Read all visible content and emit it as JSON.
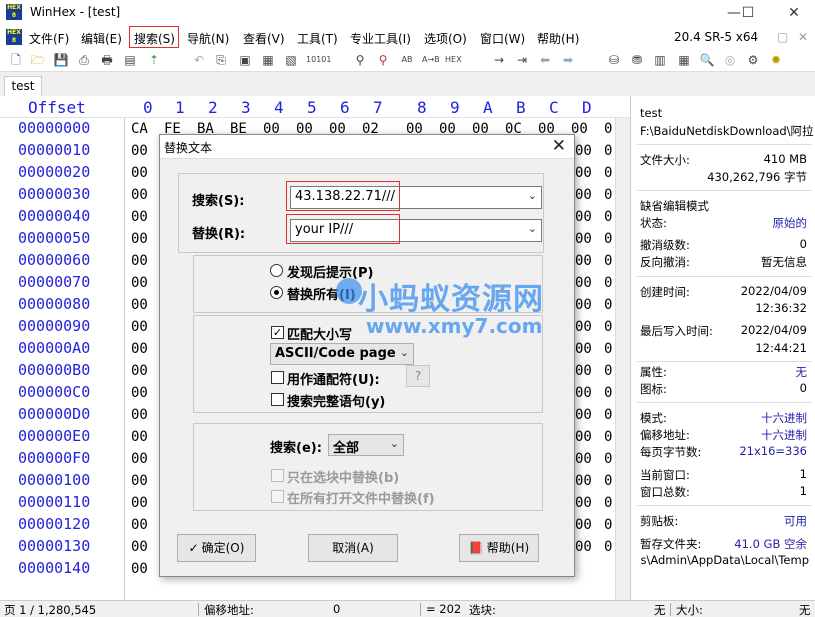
{
  "window": {
    "title": "WinHex - [test]"
  },
  "menu": {
    "items": [
      "文件(F)",
      "编辑(E)",
      "搜索(S)",
      "导航(N)",
      "查看(V)",
      "工具(T)",
      "专业工具(I)",
      "选项(O)",
      "窗口(W)",
      "帮助(H)"
    ],
    "version": "20.4 SR-5 x64"
  },
  "tab": {
    "label": "test"
  },
  "hex": {
    "offset_header": "Offset",
    "col_headers": [
      "0",
      "1",
      "2",
      "3",
      "4",
      "5",
      "6",
      "7",
      "8",
      "9",
      "A",
      "B",
      "C",
      "D"
    ],
    "offsets": [
      "00000000",
      "00000010",
      "00000020",
      "00000030",
      "00000040",
      "00000050",
      "00000060",
      "00000070",
      "00000080",
      "00000090",
      "000000A0",
      "000000B0",
      "000000C0",
      "000000D0",
      "000000E0",
      "000000F0",
      "00000100",
      "00000110",
      "00000120",
      "00000130",
      "00000140"
    ],
    "row0": [
      "CA",
      "FE",
      "BA",
      "BE",
      "00",
      "00",
      "00",
      "02",
      "00",
      "00",
      "00",
      "0C",
      "00",
      "00"
    ],
    "left_col": "00",
    "right_col": "00",
    "right_col2": "0"
  },
  "side": {
    "filename": "test",
    "path": "F:\\BaiduNetdiskDownload\\阿拉",
    "filesize_label": "文件大小:",
    "filesize_mb": "410 MB",
    "filesize_bytes": "430,262,796 字节",
    "default_edit_mode": "缺省编辑模式",
    "state_label": "状态:",
    "state_value": "原始的",
    "undo_label": "撤消级数:",
    "undo_value": "0",
    "reverse_undo_label": "反向撤消:",
    "reverse_undo_value": "暂无信息",
    "created_label": "创建时间:",
    "created_date": "2022/04/09",
    "created_time": "12:36:32",
    "written_label": "最后写入时间:",
    "written_date": "2022/04/09",
    "written_time": "12:44:21",
    "attr_label": "属性:",
    "attr_value": "无",
    "icon_label": "图标:",
    "icon_value": "0",
    "mode_label": "模式:",
    "mode_value": "十六进制",
    "offset_label": "偏移地址:",
    "offset_value": "十六进制",
    "bpp_label": "每页字节数:",
    "bpp_value": "21x16=336",
    "curwin_label": "当前窗口:",
    "curwin_value": "1",
    "totalwin_label": "窗口总数:",
    "totalwin_value": "1",
    "clip_label": "剪贴板:",
    "clip_value": "可用",
    "temp_label": "暂存文件夹:",
    "temp_value": "41.0 GB 空余",
    "temp_path": "s\\Admin\\AppData\\Local\\Temp"
  },
  "status": {
    "page": "页 1 / 1,280,545",
    "offset_label": "偏移地址:",
    "offset_value": "0",
    "eq": "= 202",
    "select_label": "选块:",
    "none1": "无",
    "size_label": "大小:",
    "none2": "无"
  },
  "dialog": {
    "title": "替换文本",
    "search_label": "搜索(S):",
    "search_value": "43.138.22.71///",
    "replace_label": "替换(R):",
    "replace_value": "your IP///",
    "prompt_option": "发现后提示(P)",
    "replace_all_option": "替换所有(I)",
    "match_case": "匹配大小写",
    "encoding": "ASCII/Code page",
    "wildcard": "用作通配符(U):",
    "wildcard_char": "?",
    "whole_words": "搜索完整语句(y)",
    "scope_label": "搜索(e):",
    "scope_value": "全部",
    "in_block": "只在选块中替换(b)",
    "all_open": "在所有打开文件中替换(f)",
    "ok": "确定(O)",
    "cancel": "取消(A)",
    "help": "帮助(H)"
  },
  "watermark": {
    "line1": "小蚂蚁资源网",
    "line2": "www.xmy7.com"
  }
}
